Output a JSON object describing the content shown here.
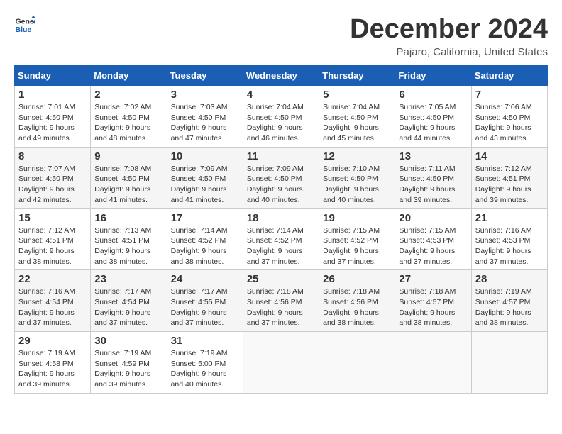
{
  "header": {
    "logo_line1": "General",
    "logo_line2": "Blue",
    "title": "December 2024",
    "subtitle": "Pajaro, California, United States"
  },
  "weekdays": [
    "Sunday",
    "Monday",
    "Tuesday",
    "Wednesday",
    "Thursday",
    "Friday",
    "Saturday"
  ],
  "weeks": [
    [
      {
        "day": "1",
        "sunrise": "7:01 AM",
        "sunset": "4:50 PM",
        "daylight": "9 hours and 49 minutes."
      },
      {
        "day": "2",
        "sunrise": "7:02 AM",
        "sunset": "4:50 PM",
        "daylight": "9 hours and 48 minutes."
      },
      {
        "day": "3",
        "sunrise": "7:03 AM",
        "sunset": "4:50 PM",
        "daylight": "9 hours and 47 minutes."
      },
      {
        "day": "4",
        "sunrise": "7:04 AM",
        "sunset": "4:50 PM",
        "daylight": "9 hours and 46 minutes."
      },
      {
        "day": "5",
        "sunrise": "7:04 AM",
        "sunset": "4:50 PM",
        "daylight": "9 hours and 45 minutes."
      },
      {
        "day": "6",
        "sunrise": "7:05 AM",
        "sunset": "4:50 PM",
        "daylight": "9 hours and 44 minutes."
      },
      {
        "day": "7",
        "sunrise": "7:06 AM",
        "sunset": "4:50 PM",
        "daylight": "9 hours and 43 minutes."
      }
    ],
    [
      {
        "day": "8",
        "sunrise": "7:07 AM",
        "sunset": "4:50 PM",
        "daylight": "9 hours and 42 minutes."
      },
      {
        "day": "9",
        "sunrise": "7:08 AM",
        "sunset": "4:50 PM",
        "daylight": "9 hours and 41 minutes."
      },
      {
        "day": "10",
        "sunrise": "7:09 AM",
        "sunset": "4:50 PM",
        "daylight": "9 hours and 41 minutes."
      },
      {
        "day": "11",
        "sunrise": "7:09 AM",
        "sunset": "4:50 PM",
        "daylight": "9 hours and 40 minutes."
      },
      {
        "day": "12",
        "sunrise": "7:10 AM",
        "sunset": "4:50 PM",
        "daylight": "9 hours and 40 minutes."
      },
      {
        "day": "13",
        "sunrise": "7:11 AM",
        "sunset": "4:50 PM",
        "daylight": "9 hours and 39 minutes."
      },
      {
        "day": "14",
        "sunrise": "7:12 AM",
        "sunset": "4:51 PM",
        "daylight": "9 hours and 39 minutes."
      }
    ],
    [
      {
        "day": "15",
        "sunrise": "7:12 AM",
        "sunset": "4:51 PM",
        "daylight": "9 hours and 38 minutes."
      },
      {
        "day": "16",
        "sunrise": "7:13 AM",
        "sunset": "4:51 PM",
        "daylight": "9 hours and 38 minutes."
      },
      {
        "day": "17",
        "sunrise": "7:14 AM",
        "sunset": "4:52 PM",
        "daylight": "9 hours and 38 minutes."
      },
      {
        "day": "18",
        "sunrise": "7:14 AM",
        "sunset": "4:52 PM",
        "daylight": "9 hours and 37 minutes."
      },
      {
        "day": "19",
        "sunrise": "7:15 AM",
        "sunset": "4:52 PM",
        "daylight": "9 hours and 37 minutes."
      },
      {
        "day": "20",
        "sunrise": "7:15 AM",
        "sunset": "4:53 PM",
        "daylight": "9 hours and 37 minutes."
      },
      {
        "day": "21",
        "sunrise": "7:16 AM",
        "sunset": "4:53 PM",
        "daylight": "9 hours and 37 minutes."
      }
    ],
    [
      {
        "day": "22",
        "sunrise": "7:16 AM",
        "sunset": "4:54 PM",
        "daylight": "9 hours and 37 minutes."
      },
      {
        "day": "23",
        "sunrise": "7:17 AM",
        "sunset": "4:54 PM",
        "daylight": "9 hours and 37 minutes."
      },
      {
        "day": "24",
        "sunrise": "7:17 AM",
        "sunset": "4:55 PM",
        "daylight": "9 hours and 37 minutes."
      },
      {
        "day": "25",
        "sunrise": "7:18 AM",
        "sunset": "4:56 PM",
        "daylight": "9 hours and 37 minutes."
      },
      {
        "day": "26",
        "sunrise": "7:18 AM",
        "sunset": "4:56 PM",
        "daylight": "9 hours and 38 minutes."
      },
      {
        "day": "27",
        "sunrise": "7:18 AM",
        "sunset": "4:57 PM",
        "daylight": "9 hours and 38 minutes."
      },
      {
        "day": "28",
        "sunrise": "7:19 AM",
        "sunset": "4:57 PM",
        "daylight": "9 hours and 38 minutes."
      }
    ],
    [
      {
        "day": "29",
        "sunrise": "7:19 AM",
        "sunset": "4:58 PM",
        "daylight": "9 hours and 39 minutes."
      },
      {
        "day": "30",
        "sunrise": "7:19 AM",
        "sunset": "4:59 PM",
        "daylight": "9 hours and 39 minutes."
      },
      {
        "day": "31",
        "sunrise": "7:19 AM",
        "sunset": "5:00 PM",
        "daylight": "9 hours and 40 minutes."
      },
      null,
      null,
      null,
      null
    ]
  ]
}
